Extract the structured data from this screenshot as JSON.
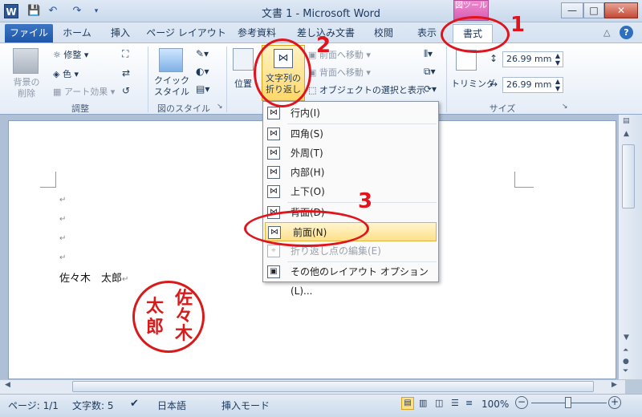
{
  "title_bar": {
    "app_title": "文書 1  -  Microsoft Word",
    "context_tab_label": "図ツール",
    "minimize": "—",
    "maximize": "□",
    "close": "✕",
    "app_icon_letter": "W"
  },
  "tabs": {
    "file": "ファイル",
    "items": [
      "ホーム",
      "挿入",
      "ページ レイアウト",
      "参考資料",
      "差し込み文書",
      "校閲",
      "表示",
      "書式"
    ],
    "active": "書式"
  },
  "ribbon": {
    "remove_bg": "背景の\n削除",
    "adjust_corrections": "修整",
    "adjust_color": "色",
    "adjust_art": "アート効果",
    "group_adjust": "調整",
    "quick_styles": "クイック\nスタイル",
    "group_picture_styles": "図のスタイル",
    "position": "位置",
    "wrap_text": "文字列の\n折り返し",
    "bring_forward": "前面へ移動",
    "send_backward": "背面へ移動",
    "selection_pane": "オブジェクトの選択と表示",
    "group_size": "サイズ",
    "crop": "トリミング",
    "height_value": "26.99 mm",
    "width_value": "26.99 mm"
  },
  "wrap_menu": {
    "items": [
      {
        "label": "行内(I)",
        "state": "normal"
      },
      {
        "label": "四角(S)",
        "state": "normal"
      },
      {
        "label": "外周(T)",
        "state": "normal"
      },
      {
        "label": "内部(H)",
        "state": "normal"
      },
      {
        "label": "上下(O)",
        "state": "normal"
      },
      {
        "label": "背面(D)",
        "state": "normal"
      },
      {
        "label": "前面(N)",
        "state": "highlighted"
      },
      {
        "label": "折り返し点の編集(E)",
        "state": "disabled"
      },
      {
        "label": "その他のレイアウト オプション(L)...",
        "state": "normal"
      }
    ]
  },
  "document": {
    "name_text": "佐々木　太郎",
    "stamp_chars": [
      "佐",
      "々",
      "木",
      "太",
      "郎"
    ]
  },
  "annotations": {
    "n1": "1",
    "n2": "2",
    "n3": "3",
    "color": "#e0141c"
  },
  "status_bar": {
    "page": "ページ: 1/1",
    "words": "文字数: 5",
    "language": "日本語",
    "mode": "挿入モード",
    "zoom": "100%"
  }
}
